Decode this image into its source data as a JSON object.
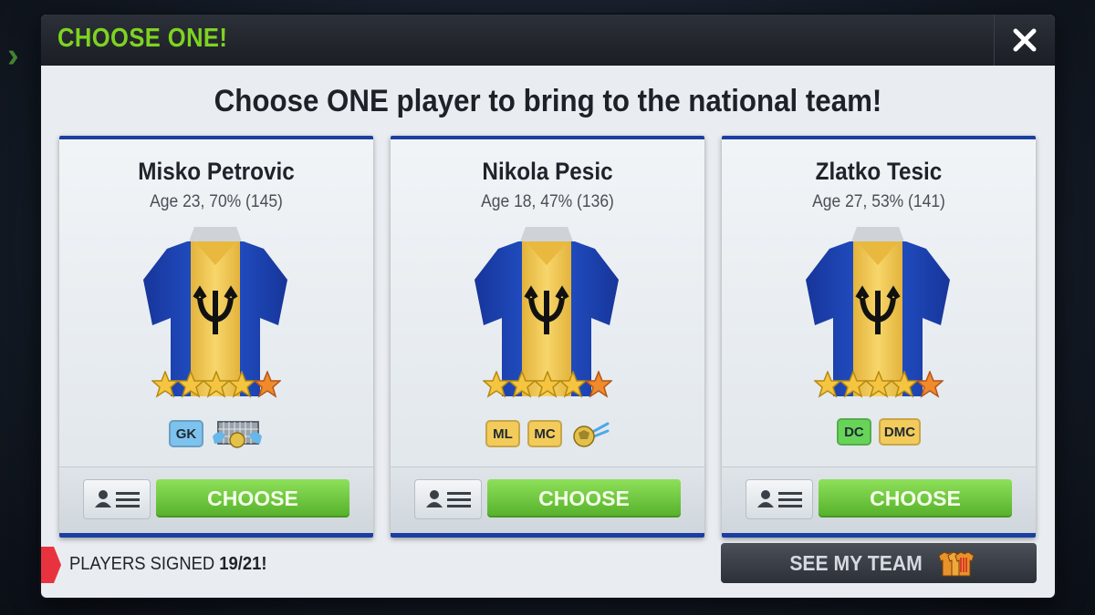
{
  "background": {
    "chevron": "›"
  },
  "modal": {
    "title": "CHOOSE ONE!",
    "close_icon": "close-icon",
    "headline": "Choose ONE player to bring to the national team!"
  },
  "colors": {
    "title_green": "#7ed321",
    "card_border_blue": "#1b3fa0",
    "choose_green": "#55b02a",
    "jersey_blue": "#1f4fbf",
    "jersey_gold": "#f2c94c"
  },
  "players": [
    {
      "name": "Misko Petrovic",
      "age_line": "Age 23, 70% (145)",
      "stars": 5,
      "positions": [
        {
          "label": "GK",
          "color": "blue"
        }
      ],
      "skill_icon": "goalkeeper-net-icon",
      "choose_label": "CHOOSE"
    },
    {
      "name": "Nikola Pesic",
      "age_line": "Age 18, 47% (136)",
      "stars": 5,
      "positions": [
        {
          "label": "ML",
          "color": "yellow"
        },
        {
          "label": "MC",
          "color": "yellow"
        }
      ],
      "skill_icon": "kicked-ball-icon",
      "choose_label": "CHOOSE"
    },
    {
      "name": "Zlatko Tesic",
      "age_line": "Age 27, 53% (141)",
      "stars": 5,
      "positions": [
        {
          "label": "DC",
          "color": "green"
        },
        {
          "label": "DMC",
          "color": "yellow"
        }
      ],
      "skill_icon": "",
      "choose_label": "CHOOSE"
    }
  ],
  "footer": {
    "signed_label": "PLAYERS SIGNED ",
    "signed_count": "19/21!",
    "see_team_label": "SEE MY TEAM",
    "see_team_icon": "team-shirts-icon"
  }
}
